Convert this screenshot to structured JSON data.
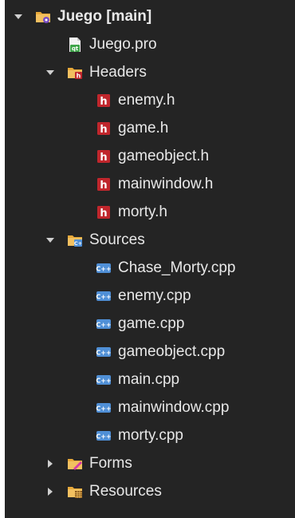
{
  "tree": {
    "project": {
      "label": "Juego [main]",
      "icon": "qt-project-folder-icon",
      "expanded": true
    },
    "pro_file": {
      "label": "Juego.pro",
      "icon": "qt-pro-file-icon"
    },
    "headers": {
      "label": "Headers",
      "icon": "headers-folder-icon",
      "expanded": true,
      "items": [
        {
          "label": "enemy.h"
        },
        {
          "label": "game.h"
        },
        {
          "label": "gameobject.h"
        },
        {
          "label": "mainwindow.h"
        },
        {
          "label": "morty.h"
        }
      ]
    },
    "sources": {
      "label": "Sources",
      "icon": "sources-folder-icon",
      "expanded": true,
      "items": [
        {
          "label": "Chase_Morty.cpp"
        },
        {
          "label": "enemy.cpp"
        },
        {
          "label": "game.cpp"
        },
        {
          "label": "gameobject.cpp"
        },
        {
          "label": "main.cpp"
        },
        {
          "label": "mainwindow.cpp"
        },
        {
          "label": "morty.cpp"
        }
      ]
    },
    "forms": {
      "label": "Forms",
      "icon": "forms-folder-icon",
      "expanded": false
    },
    "resources": {
      "label": "Resources",
      "icon": "resources-folder-icon",
      "expanded": false
    }
  },
  "colors": {
    "background": "#242424",
    "text": "#e8e8e8",
    "folder": "#e8a93a",
    "header_badge": "#c0262c",
    "cpp_badge": "#4f8fd6"
  }
}
